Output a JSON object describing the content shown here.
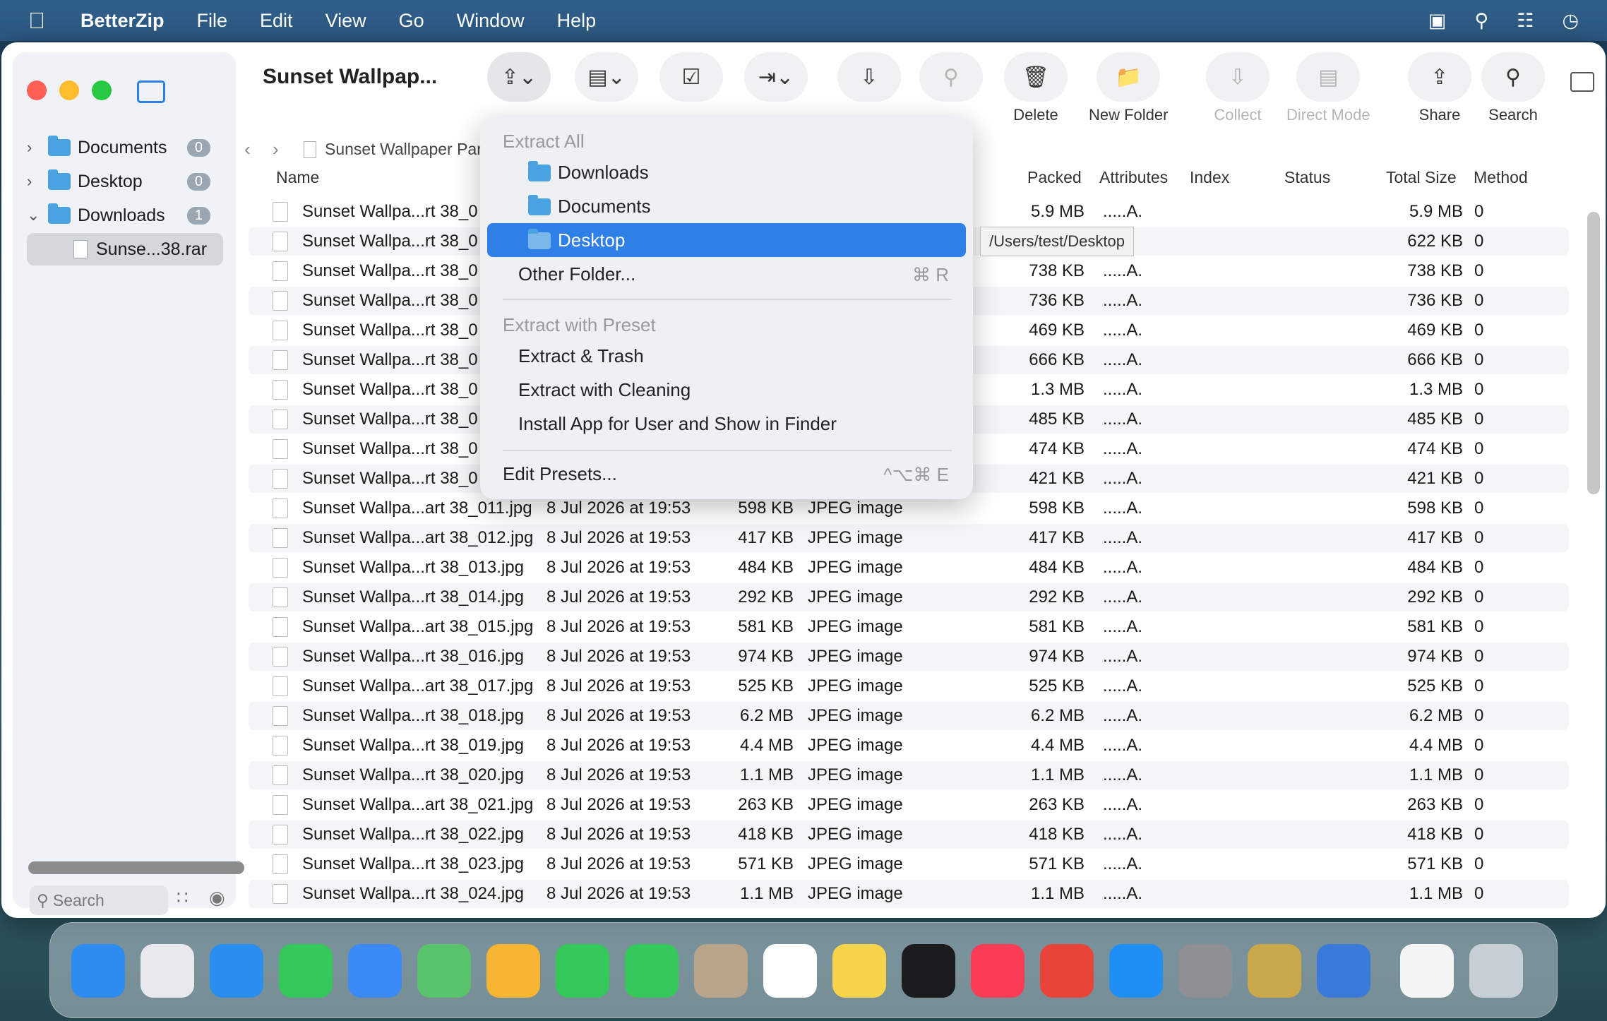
{
  "menubar": {
    "app": "BetterZip",
    "items": [
      "File",
      "Edit",
      "View",
      "Go",
      "Window",
      "Help"
    ]
  },
  "window": {
    "title": "Sunset Wallpap..."
  },
  "sidebar": {
    "items": [
      {
        "label": "Documents",
        "badge": "0"
      },
      {
        "label": "Desktop",
        "badge": "0"
      },
      {
        "label": "Downloads",
        "badge": "1"
      },
      {
        "label": "Sunse...38.rar"
      }
    ],
    "search_placeholder": "Search"
  },
  "toolbar": {
    "labels": [
      "Delete",
      "New Folder",
      "Collect",
      "Direct Mode",
      "Share",
      "Search"
    ]
  },
  "path": {
    "label": "Sunset Wallpaper Par"
  },
  "columns": {
    "name": "Name",
    "packed": "Packed",
    "attributes": "Attributes",
    "index": "Index",
    "status": "Status",
    "total": "Total Size",
    "method": "Method"
  },
  "menu": {
    "extract_all": "Extract All",
    "downloads": "Downloads",
    "documents": "Documents",
    "desktop": "Desktop",
    "other": "Other Folder...",
    "other_key": "⌘ R",
    "preset_hdr": "Extract with Preset",
    "trash": "Extract & Trash",
    "cleaning": "Extract with Cleaning",
    "install": "Install App for User and Show in Finder",
    "edit": "Edit Presets...",
    "edit_key": "^⌥⌘ E"
  },
  "tooltip": "/Users/test/Desktop",
  "rows_top": [
    {
      "name": "Sunset Wallpa...rt 38_0",
      "packed": "5.9 MB",
      "attr": ".....A.",
      "total": "5.9 MB",
      "method": "0"
    },
    {
      "name": "Sunset Wallpa...rt 38_0",
      "packed": "",
      "attr": "",
      "total": "622 KB",
      "method": "0"
    },
    {
      "name": "Sunset Wallpa...rt 38_0",
      "packed": "738 KB",
      "attr": ".....A.",
      "total": "738 KB",
      "method": "0"
    },
    {
      "name": "Sunset Wallpa...rt 38_0",
      "packed": "736 KB",
      "attr": ".....A.",
      "total": "736 KB",
      "method": "0"
    },
    {
      "name": "Sunset Wallpa...rt 38_0",
      "packed": "469 KB",
      "attr": ".....A.",
      "total": "469 KB",
      "method": "0"
    },
    {
      "name": "Sunset Wallpa...rt 38_0",
      "packed": "666 KB",
      "attr": ".....A.",
      "total": "666 KB",
      "method": "0"
    },
    {
      "name": "Sunset Wallpa...rt 38_0",
      "packed": "1.3 MB",
      "attr": ".....A.",
      "total": "1.3 MB",
      "method": "0"
    },
    {
      "name": "Sunset Wallpa...rt 38_0",
      "packed": "485 KB",
      "attr": ".....A.",
      "total": "485 KB",
      "method": "0"
    },
    {
      "name": "Sunset Wallpa...rt 38_0",
      "packed": "474 KB",
      "attr": ".....A.",
      "total": "474 KB",
      "method": "0"
    },
    {
      "name": "Sunset Wallpa...rt 38_0",
      "packed": "421 KB",
      "attr": ".....A.",
      "total": "421 KB",
      "method": "0"
    }
  ],
  "rows": [
    {
      "name": "Sunset Wallpa...art 38_011.jpg",
      "date": "8 Jul 2026 at 19:53",
      "size": "598 KB",
      "kind": "JPEG image",
      "packed": "598 KB",
      "attr": ".....A.",
      "total": "598 KB",
      "method": "0"
    },
    {
      "name": "Sunset Wallpa...art 38_012.jpg",
      "date": "8 Jul 2026 at 19:53",
      "size": "417 KB",
      "kind": "JPEG image",
      "packed": "417 KB",
      "attr": ".....A.",
      "total": "417 KB",
      "method": "0"
    },
    {
      "name": "Sunset Wallpa...rt 38_013.jpg",
      "date": "8 Jul 2026 at 19:53",
      "size": "484 KB",
      "kind": "JPEG image",
      "packed": "484 KB",
      "attr": ".....A.",
      "total": "484 KB",
      "method": "0"
    },
    {
      "name": "Sunset Wallpa...rt 38_014.jpg",
      "date": "8 Jul 2026 at 19:53",
      "size": "292 KB",
      "kind": "JPEG image",
      "packed": "292 KB",
      "attr": ".....A.",
      "total": "292 KB",
      "method": "0"
    },
    {
      "name": "Sunset Wallpa...art 38_015.jpg",
      "date": "8 Jul 2026 at 19:53",
      "size": "581 KB",
      "kind": "JPEG image",
      "packed": "581 KB",
      "attr": ".....A.",
      "total": "581 KB",
      "method": "0"
    },
    {
      "name": "Sunset Wallpa...rt 38_016.jpg",
      "date": "8 Jul 2026 at 19:53",
      "size": "974 KB",
      "kind": "JPEG image",
      "packed": "974 KB",
      "attr": ".....A.",
      "total": "974 KB",
      "method": "0"
    },
    {
      "name": "Sunset Wallpa...art 38_017.jpg",
      "date": "8 Jul 2026 at 19:53",
      "size": "525 KB",
      "kind": "JPEG image",
      "packed": "525 KB",
      "attr": ".....A.",
      "total": "525 KB",
      "method": "0"
    },
    {
      "name": "Sunset Wallpa...rt 38_018.jpg",
      "date": "8 Jul 2026 at 19:53",
      "size": "6.2 MB",
      "kind": "JPEG image",
      "packed": "6.2 MB",
      "attr": ".....A.",
      "total": "6.2 MB",
      "method": "0"
    },
    {
      "name": "Sunset Wallpa...rt 38_019.jpg",
      "date": "8 Jul 2026 at 19:53",
      "size": "4.4 MB",
      "kind": "JPEG image",
      "packed": "4.4 MB",
      "attr": ".....A.",
      "total": "4.4 MB",
      "method": "0"
    },
    {
      "name": "Sunset Wallpa...rt 38_020.jpg",
      "date": "8 Jul 2026 at 19:53",
      "size": "1.1 MB",
      "kind": "JPEG image",
      "packed": "1.1 MB",
      "attr": ".....A.",
      "total": "1.1 MB",
      "method": "0"
    },
    {
      "name": "Sunset Wallpa...art 38_021.jpg",
      "date": "8 Jul 2026 at 19:53",
      "size": "263 KB",
      "kind": "JPEG image",
      "packed": "263 KB",
      "attr": ".....A.",
      "total": "263 KB",
      "method": "0"
    },
    {
      "name": "Sunset Wallpa...rt 38_022.jpg",
      "date": "8 Jul 2026 at 19:53",
      "size": "418 KB",
      "kind": "JPEG image",
      "packed": "418 KB",
      "attr": ".....A.",
      "total": "418 KB",
      "method": "0"
    },
    {
      "name": "Sunset Wallpa...rt 38_023.jpg",
      "date": "8 Jul 2026 at 19:53",
      "size": "571 KB",
      "kind": "JPEG image",
      "packed": "571 KB",
      "attr": ".....A.",
      "total": "571 KB",
      "method": "0"
    },
    {
      "name": "Sunset Wallpa...rt 38_024.jpg",
      "date": "8 Jul 2026 at 19:53",
      "size": "1.1 MB",
      "kind": "JPEG image",
      "packed": "1.1 MB",
      "attr": ".....A.",
      "total": "1.1 MB",
      "method": "0"
    }
  ],
  "dock_icons": [
    "finder",
    "launchpad",
    "safari",
    "messages",
    "mail",
    "maps",
    "photos",
    "facetime",
    "phone",
    "contacts",
    "reminders",
    "notes",
    "tv",
    "music",
    "rocket",
    "app-store",
    "system-settings",
    "betterzip",
    "app",
    "document",
    "trash"
  ],
  "dock_colors": [
    "#2e8bf0",
    "#e8e8ee",
    "#2a8df0",
    "#34c759",
    "#3b8af5",
    "#58c36a",
    "#f7b531",
    "#34c759",
    "#34c759",
    "#b8a48a",
    "#ffffff",
    "#f7d54a",
    "#1c1c1e",
    "#fa3c55",
    "#e8443a",
    "#1f8ef5",
    "#8e8e93",
    "#c9a84a",
    "#3a7ad8",
    "#f4f4f4",
    "#c8d0d6"
  ]
}
